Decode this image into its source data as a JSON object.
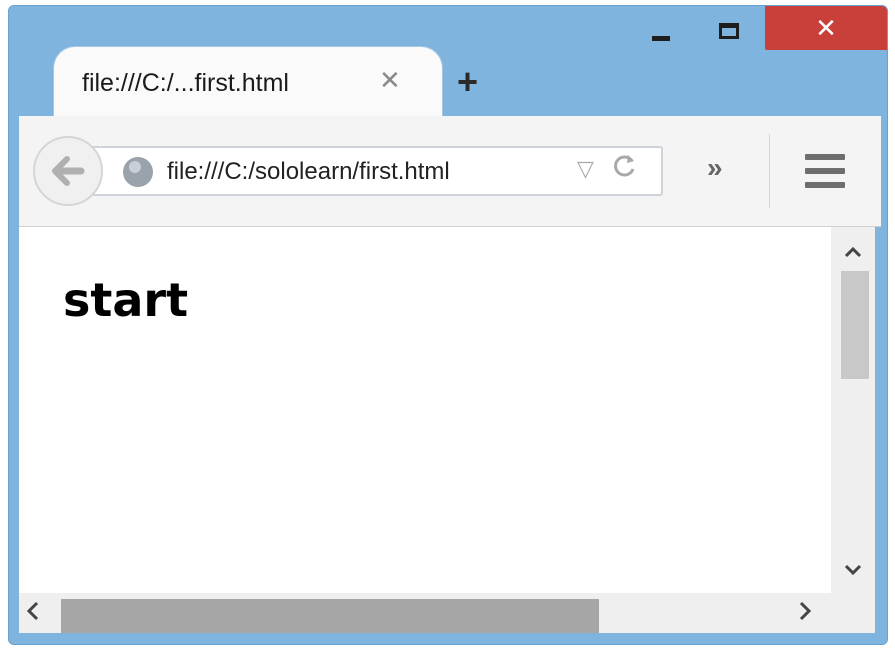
{
  "window": {
    "minimize_icon": "minimize-icon",
    "maximize_icon": "maximize-icon",
    "close_label": "✕"
  },
  "tab": {
    "title": "file:///C:/...first.html",
    "close_label": "✕",
    "new_tab_label": "+"
  },
  "toolbar": {
    "back_icon": "back-arrow-icon",
    "site_icon": "globe-icon",
    "url": "file:///C:/sololearn/first.html",
    "dropdown_label": "▽",
    "reload_label": "C",
    "overflow_label": "»",
    "menu_icon": "hamburger-menu-icon"
  },
  "page": {
    "heading": "start"
  },
  "scrollbars": {
    "up_label": "^",
    "down_label": "v",
    "left_label": "<",
    "right_label": ">"
  },
  "colors": {
    "frame": "#7fb4de",
    "close_button": "#c9403a",
    "scroll_thumb": "#a6a6a6"
  }
}
